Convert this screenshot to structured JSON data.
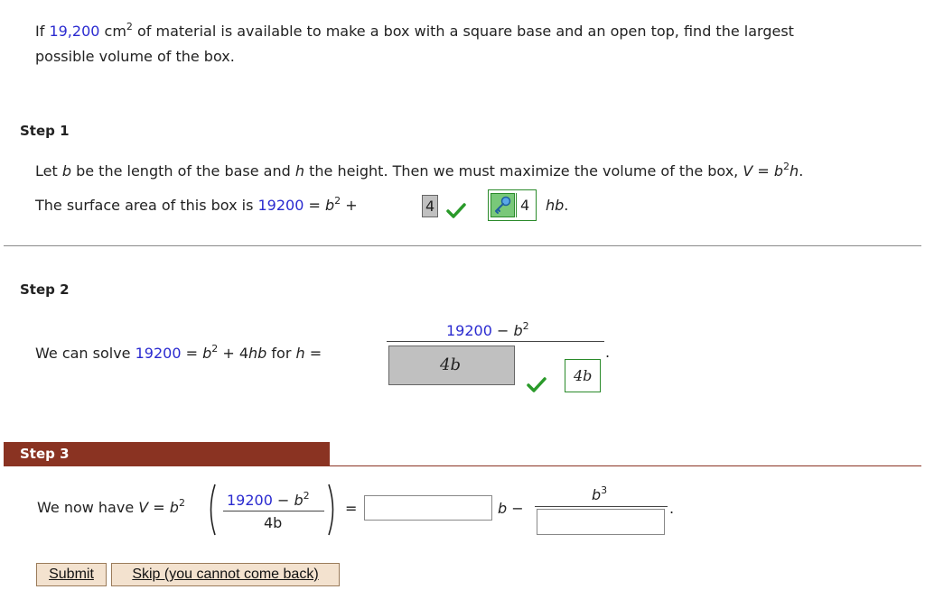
{
  "problem": {
    "prefix": "If ",
    "area_value": "19,200",
    "area_unit": "cm",
    "area_exp": "2",
    "rest": " of material is available to make a box with a square base and an open top, find the largest",
    "line2": "possible volume of the box."
  },
  "step1": {
    "heading": "Step 1",
    "text_a": "Let ",
    "var_b": "b",
    "text_b": " be the length of the base and ",
    "var_h": "h",
    "text_c": " the height. Then we must maximize the volume of the box, ",
    "V": "V",
    "eq": " = ",
    "b2h_b": "b",
    "b2h_exp": "2",
    "b2h_h": "h",
    "period": ".",
    "sa_text": "The surface area of this box is ",
    "sa_value": "19200",
    "sa_eq": " = ",
    "sa_b": "b",
    "sa_exp": "2",
    "sa_plus": " + ",
    "answer1": "4",
    "answer2": "4",
    "hb": "hb",
    "hb_period": "."
  },
  "step2": {
    "heading": "Step 2",
    "text_a": "We can solve ",
    "value": "19200",
    "eq_rest_a": " = ",
    "b": "b",
    "exp": "2",
    "eq_rest_b": " + 4",
    "hb": "hb",
    "for_text": " for ",
    "h": "h",
    "h_eq": " =",
    "num_value": "19200",
    "num_minus": " − ",
    "num_b": "b",
    "num_exp": "2",
    "den_answer": "4b",
    "den_correct": "4b",
    "period": "."
  },
  "step3": {
    "heading": "Step 3",
    "text_a": "We now have ",
    "V": "V",
    "eq": " = ",
    "b": "b",
    "exp": "2",
    "frac_num_value": "19200",
    "frac_num_minus": " − ",
    "frac_num_b": "b",
    "frac_num_exp": "2",
    "frac_den": "4b",
    "equals": "=",
    "mid_b": "b",
    "minus": " −",
    "b3_b": "b",
    "b3_exp": "3",
    "period": "."
  },
  "buttons": {
    "submit": "Submit",
    "skip": "Skip (you cannot come back)"
  },
  "colors": {
    "step3_header": "#8a3322",
    "blue_value": "#2b2bd0",
    "correct_green": "#2a9a2a",
    "answer_gray": "#c0c0c0"
  }
}
